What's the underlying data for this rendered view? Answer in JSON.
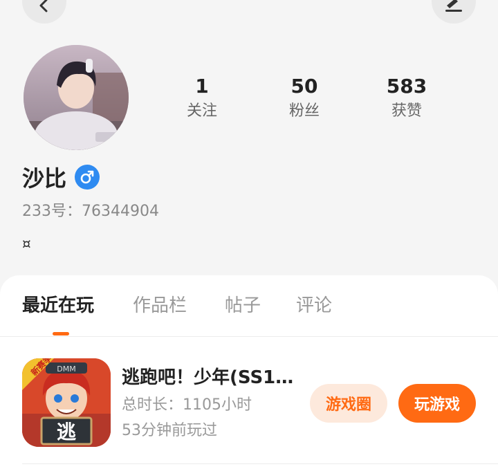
{
  "profile": {
    "name": "沙比",
    "gender_icon": "male-icon",
    "uid_label": "233号：76344904",
    "bio": "¤"
  },
  "stats": [
    {
      "value": "1",
      "label": "关注"
    },
    {
      "value": "50",
      "label": "粉丝"
    },
    {
      "value": "583",
      "label": "获赞"
    }
  ],
  "tabs": [
    {
      "label": "最近在玩",
      "active": true
    },
    {
      "label": "作品栏",
      "active": false
    },
    {
      "label": "帖子",
      "active": false
    },
    {
      "label": "评论",
      "active": false
    }
  ],
  "game": {
    "title": "逃跑吧！少年(SS1…",
    "duration": "总时长：1105小时",
    "last_played": "53分钟前玩过",
    "icon_badge": "新赛季",
    "icon_brand": "DMM",
    "icon_char": "逃",
    "circle_button": "游戏圈",
    "play_button": "玩游戏"
  },
  "colors": {
    "accent": "#ff6a13",
    "accent_light": "#fde9dc",
    "gender_blue": "#2f8bf1"
  }
}
